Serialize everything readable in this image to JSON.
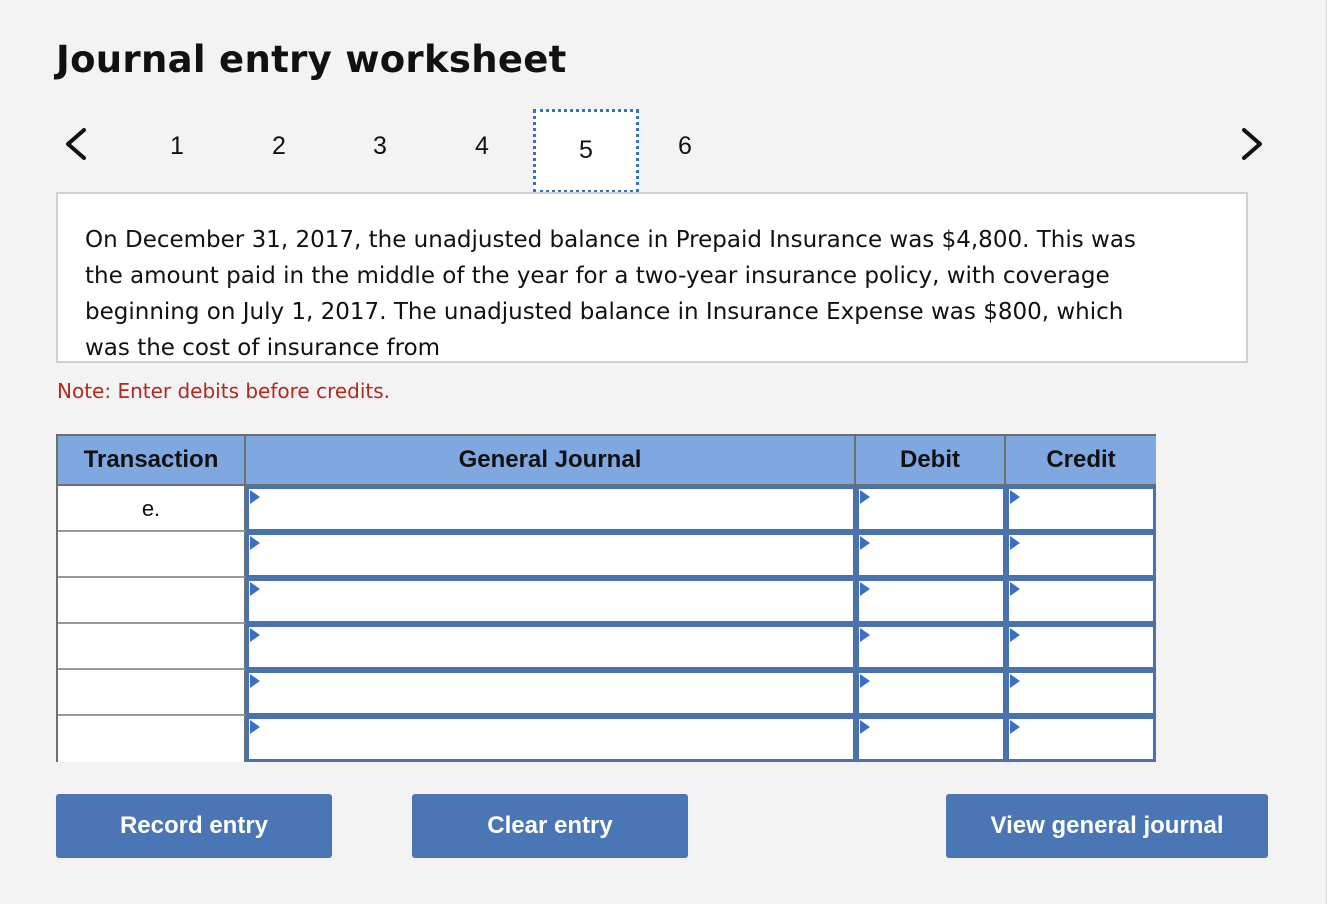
{
  "title": "Journal entry worksheet",
  "nav": {
    "prev_icon": "chevron-left-icon",
    "next_icon": "chevron-right-icon",
    "steps": [
      "1",
      "2",
      "3",
      "4",
      "5",
      "6"
    ],
    "active_step": "5"
  },
  "prompt": {
    "text": "On December 31, 2017, the unadjusted balance in Prepaid Insurance was $4,800. This was the amount paid in the middle of the year for a two-year insurance policy, with coverage beginning on July 1, 2017. The unadjusted balance in Insurance Expense was $800, which was the cost of insurance from"
  },
  "note": "Note: Enter debits before credits.",
  "journal": {
    "headers": {
      "transaction": "Transaction",
      "general_journal": "General Journal",
      "debit": "Debit",
      "credit": "Credit"
    },
    "rows": [
      {
        "transaction": "e.",
        "account": "",
        "debit": "",
        "credit": ""
      },
      {
        "transaction": "",
        "account": "",
        "debit": "",
        "credit": ""
      },
      {
        "transaction": "",
        "account": "",
        "debit": "",
        "credit": ""
      },
      {
        "transaction": "",
        "account": "",
        "debit": "",
        "credit": ""
      },
      {
        "transaction": "",
        "account": "",
        "debit": "",
        "credit": ""
      },
      {
        "transaction": "",
        "account": "",
        "debit": "",
        "credit": ""
      }
    ]
  },
  "buttons": {
    "record": "Record entry",
    "clear": "Clear entry",
    "view": "View general journal"
  },
  "colors": {
    "header_bg": "#7fa8e0",
    "button_bg": "#4a76b6",
    "cell_border": "#4a72ad",
    "note_text": "#b02a1e",
    "active_step_border": "#3b6fc4"
  }
}
